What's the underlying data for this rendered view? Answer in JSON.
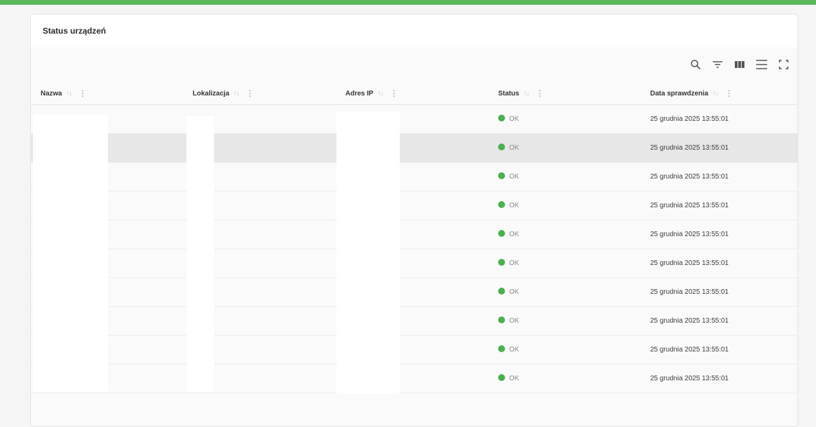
{
  "accent_color": "#5cb85c",
  "status_color": "#4caf50",
  "card": {
    "title": "Status urządzeń"
  },
  "toolbar": {
    "icons": [
      "search-icon",
      "filter-icon",
      "columns-icon",
      "density-icon",
      "fullscreen-icon"
    ]
  },
  "table": {
    "columns": [
      {
        "label": "Nazwa"
      },
      {
        "label": "Lokalizacja"
      },
      {
        "label": "Adres IP"
      },
      {
        "label": "Status"
      },
      {
        "label": "Data sprawdzenia"
      }
    ],
    "sort_glyph": "↑↓",
    "more_glyph": "⋮",
    "rows": [
      {
        "status": "OK",
        "date": "25 grudnia 2025 13:55:01"
      },
      {
        "status": "OK",
        "date": "25 grudnia 2025 13:55:01"
      },
      {
        "status": "OK",
        "date": "25 grudnia 2025 13:55:01"
      },
      {
        "status": "OK",
        "date": "25 grudnia 2025 13:55:01"
      },
      {
        "status": "OK",
        "date": "25 grudnia 2025 13:55:01"
      },
      {
        "status": "OK",
        "date": "25 grudnia 2025 13:55:01"
      },
      {
        "status": "OK",
        "date": "25 grudnia 2025 13:55:01"
      },
      {
        "status": "OK",
        "date": "25 grudnia 2025 13:55:01"
      },
      {
        "status": "OK",
        "date": "25 grudnia 2025 13:55:01"
      },
      {
        "status": "OK",
        "date": "25 grudnia 2025 13:55:01"
      }
    ]
  }
}
